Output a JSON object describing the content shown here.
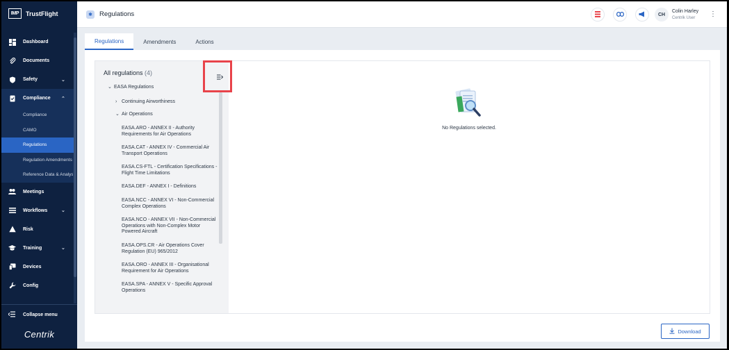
{
  "app": {
    "logo_box": "IMP",
    "logo_text": "TrustFlight",
    "brand_footer": "Centrik"
  },
  "sidebar": {
    "items": [
      {
        "label": "Dashboard",
        "icon": "dashboard-icon"
      },
      {
        "label": "Documents",
        "icon": "paperclip-icon"
      },
      {
        "label": "Safety",
        "icon": "shield-icon",
        "chevron": "⌄"
      },
      {
        "label": "Compliance",
        "icon": "document-check-icon",
        "chevron": "⌃"
      },
      {
        "label": "Meetings",
        "icon": "people-icon"
      },
      {
        "label": "Workflows",
        "icon": "list-icon",
        "chevron": "⌄"
      },
      {
        "label": "Risk",
        "icon": "warning-icon"
      },
      {
        "label": "Training",
        "icon": "graduation-cap-icon",
        "chevron": "⌄"
      },
      {
        "label": "Devices",
        "icon": "devices-icon"
      },
      {
        "label": "Config",
        "icon": "wrench-icon"
      }
    ],
    "compliance_sub": [
      {
        "label": "Compliance"
      },
      {
        "label": "CAMO"
      },
      {
        "label": "Regulations",
        "active": true
      },
      {
        "label": "Regulation Amendments"
      },
      {
        "label": "Reference Data & Analysis"
      }
    ],
    "collapse_label": "Collapse menu"
  },
  "header": {
    "title": "Regulations",
    "user_initials": "CH",
    "user_name": "Colin Harley",
    "user_role": "Centrik User"
  },
  "tabs": [
    {
      "label": "Regulations",
      "active": true
    },
    {
      "label": "Amendments"
    },
    {
      "label": "Actions"
    }
  ],
  "tree": {
    "title": "All regulations",
    "count": "(4)",
    "root": "EASA Regulations",
    "groups": [
      "Continuing Airworthiness",
      "Air Operations"
    ],
    "leaves": [
      "EASA.ARO - ANNEX II - Authority Requirements for Air Operations",
      "EASA.CAT - ANNEX IV - Commercial Air Transport Operations",
      "EASA.CS-FTL - Certification Specifications - Flight Time Limitations",
      "EASA.DEF - ANNEX I - Definitions",
      "EASA.NCC - ANNEX VI - Non-Commercial Complex Operations",
      "EASA.NCO - ANNEX VII - Non-Commercial Operations with Non-Complex Motor Powered Aircraft",
      "EASA.OPS.CR - Air Operations Cover Regulation (EU) 965/2012",
      "EASA.ORO - ANNEX III - Organisational Requirement for Air Operations",
      "EASA.SPA - ANNEX V - Specific Approval Operations"
    ]
  },
  "empty_state": {
    "message": "No Regulations selected."
  },
  "download_label": "Download",
  "colors": {
    "sidebar_bg": "#0e2140",
    "accent": "#2a65c4",
    "highlight": "#e8434a"
  }
}
